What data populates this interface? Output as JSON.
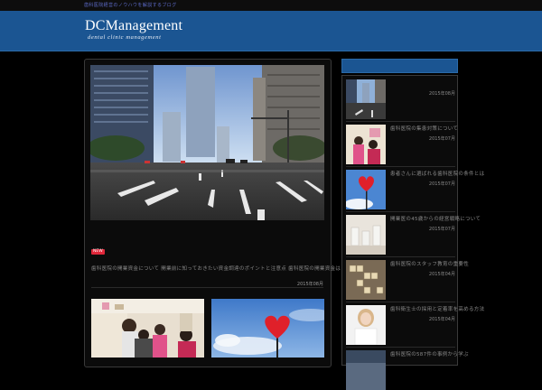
{
  "topbar": {
    "text": "歯科医院経営のノウハウを解説するブログ"
  },
  "header": {
    "logo_title": "DCManagement",
    "logo_subtitle": "dental clinic management"
  },
  "main": {
    "featured": {
      "badge": "NEW",
      "title": "歯科医院の開業資金について 開業前に知っておきたい資金調達のポイントと注意点 歯科医院の開業資金はどのくらい必要か [...]",
      "date": "2015年08月"
    }
  },
  "sidebar": {
    "items": [
      {
        "title": "",
        "date": "2015年08月"
      },
      {
        "title": "歯科医院の集患対策について",
        "date": "2015年07月"
      },
      {
        "title": "患者さんに選ばれる歯科医院の条件とは",
        "date": "2015年07月"
      },
      {
        "title": "開業医の45歳からの経営戦略について",
        "date": "2015年07月"
      },
      {
        "title": "歯科医院のスタッフ教育の重要性",
        "date": "2015年04月"
      },
      {
        "title": "歯科衛生士の採用と定着率を高める方法",
        "date": "2015年04月"
      },
      {
        "title": "歯科医院の587件の事例から学ぶ",
        "date": ""
      }
    ]
  },
  "colors": {
    "header_blue": "#1b5592",
    "badge_red": "#e0273a",
    "background": "#000000"
  }
}
